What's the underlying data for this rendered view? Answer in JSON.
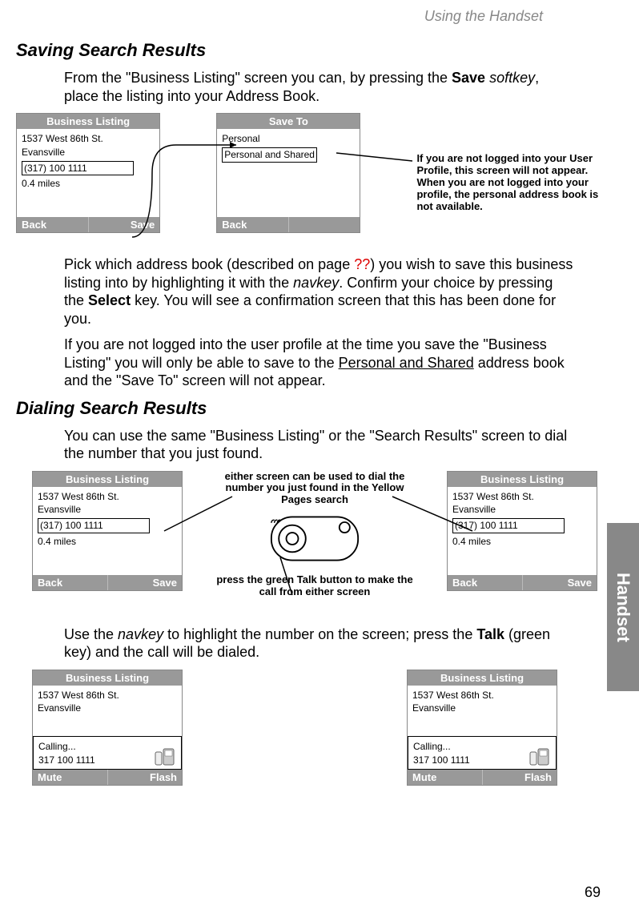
{
  "chapter": "Using the Handset",
  "page_number": "69",
  "section1": {
    "title": "Saving Search Results",
    "intro_1": "From the \"Business Listing\" screen you can, by pressing the ",
    "intro_bold": "Save",
    "intro_2": " ",
    "intro_italic": "softkey",
    "intro_3": ", place the listing into your Address Book."
  },
  "screen_business_listing": {
    "title": "Business Listing",
    "line1": "1537 West 86th St.",
    "line2": "Evansville",
    "line3": "(317) 100 1111",
    "line4": "0.4 miles",
    "sk_left": "Back",
    "sk_right": "Save"
  },
  "screen_save_to": {
    "title": "Save To",
    "opt1": "Personal",
    "opt2": "Personal and Shared",
    "sk_left": "Back",
    "sk_right": ""
  },
  "annotation_profile": "If you are not logged into your User Profile, this screen will not appear. When you are not logged into your profile, the personal address book is not available.",
  "para2_a": "Pick which address book (described on page ",
  "para2_ref": "??",
  "para2_b": ") you wish to save this business listing into by highlighting it with the ",
  "para2_italic": "navkey",
  "para2_c": ". Confirm your choice by pressing the ",
  "para2_bold": "Select",
  "para2_d": " key. You will see a confirmation screen that this has been done for you.",
  "para3_a": "If you are not logged into the user profile at the time you save the \"Business Listing\" you will only be able to save to the ",
  "para3_u": "Personal and Shared",
  "para3_b": " address book and the \"Save To\" screen will not appear.",
  "section2": {
    "title": "Dialing Search Results",
    "intro": "You can use the same \"Business Listing\" or the \"Search Results\" screen to dial the number that you just found."
  },
  "annotation_dial1": "either screen can be used to dial the number you just found in the Yellow Pages search",
  "annotation_dial2": "press the green Talk button to make the call from either screen",
  "para4_a": "Use the ",
  "para4_italic": "navkey",
  "para4_b": " to highlight the number on the screen; press the ",
  "para4_bold": "Talk",
  "para4_c": " (green key) and the call will be dialed.",
  "screen_calling": {
    "title": "Business Listing",
    "line1": "1537 West 86th St.",
    "line2": "Evansville",
    "calling_label": "Calling...",
    "calling_number": "317 100 1111",
    "sk_left": "Mute",
    "sk_right": "Flash"
  },
  "side_tab": "Handset"
}
